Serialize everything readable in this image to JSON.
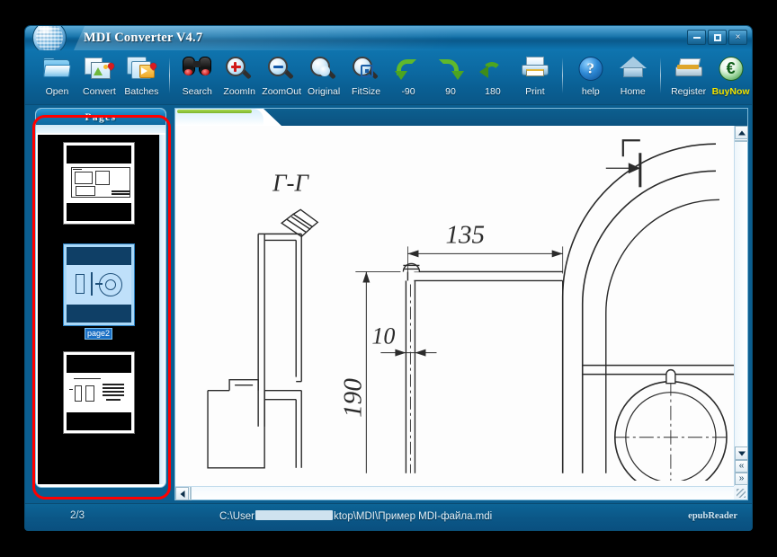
{
  "window": {
    "title": "MDI Converter V4.7",
    "logo_icon": "globe-icon",
    "controls": [
      {
        "name": "minimize",
        "glyph": ""
      },
      {
        "name": "maximize",
        "glyph": ""
      },
      {
        "name": "close",
        "glyph": "×"
      }
    ]
  },
  "toolbar": {
    "items": [
      {
        "label": "Open",
        "icon": "folder-open-icon"
      },
      {
        "label": "Convert",
        "icon": "convert-images-icon"
      },
      {
        "label": "Batches",
        "icon": "batch-folder-icon"
      },
      {
        "label": "Search",
        "icon": "binoculars-icon"
      },
      {
        "label": "ZoomIn",
        "icon": "magnifier-plus-icon"
      },
      {
        "label": "ZoomOut",
        "icon": "magnifier-minus-icon"
      },
      {
        "label": "Original",
        "icon": "magnifier-original-icon"
      },
      {
        "label": "FitSize",
        "icon": "magnifier-fit-icon"
      },
      {
        "label": "-90",
        "icon": "rotate-left-icon"
      },
      {
        "label": "90",
        "icon": "rotate-right-icon"
      },
      {
        "label": "180",
        "icon": "rotate-180-icon"
      },
      {
        "label": "Print",
        "icon": "printer-icon"
      },
      {
        "label": "help",
        "icon": "question-circle-icon"
      },
      {
        "label": "Home",
        "icon": "house-icon"
      },
      {
        "label": "Register",
        "icon": "register-card-icon"
      },
      {
        "label": "BuyNow",
        "icon": "euro-coin-icon"
      }
    ],
    "buynow_color": "#f2e400"
  },
  "pages_panel": {
    "header": "Pages",
    "thumbnails": [
      {
        "label": "",
        "selected": false,
        "page": 1
      },
      {
        "label": "page2",
        "selected": true,
        "page": 2
      },
      {
        "label": "",
        "selected": false,
        "page": 3
      }
    ],
    "highlight_color": "#ff0000"
  },
  "viewer": {
    "tab_accent_color": "#8ec93a",
    "drawing": {
      "title": "technical-drawing",
      "labels": [
        "Г-Г",
        "135",
        "10",
        "190",
        "Г"
      ]
    },
    "scrollbar": {
      "up_arrow": "▲",
      "down_arrow": "▼",
      "left_arrow": "◄",
      "right_arrow": "►",
      "page_up": "«",
      "page_down": "»"
    }
  },
  "statusbar": {
    "page_indicator": "2/3",
    "path_prefix": "C:\\User",
    "path_suffix": "ktop\\MDI\\Пример MDI-файла.mdi",
    "brand": "epubReader"
  }
}
